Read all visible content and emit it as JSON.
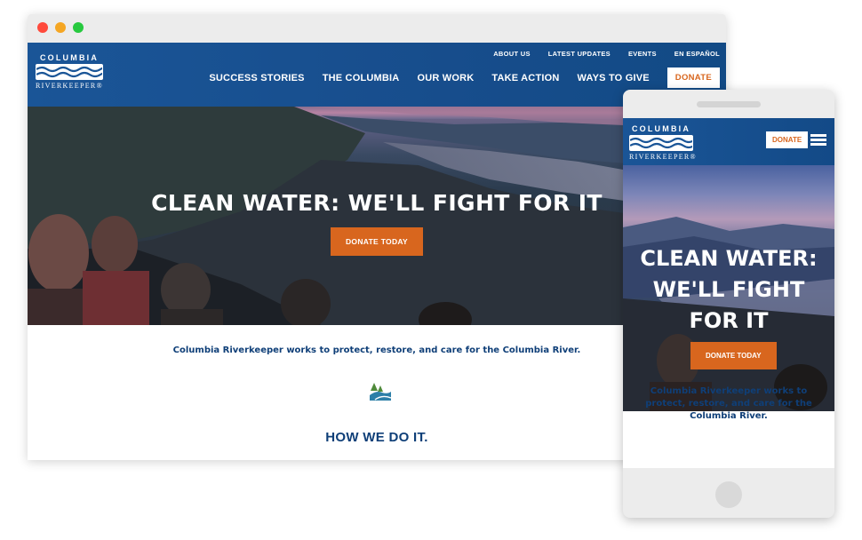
{
  "site": {
    "logo_top": "COLUMBIA",
    "logo_bottom": "RIVERKEEPER®"
  },
  "utility_nav": [
    "ABOUT US",
    "LATEST UPDATES",
    "EVENTS",
    "EN ESPAÑOL"
  ],
  "main_nav": [
    "SUCCESS STORIES",
    "THE COLUMBIA",
    "OUR WORK",
    "TAKE ACTION",
    "WAYS TO GIVE"
  ],
  "donate_label": "DONATE",
  "hero": {
    "title": "CLEAN WATER: WE'LL FIGHT FOR IT",
    "button": "DONATE TODAY"
  },
  "mission": "Columbia Riverkeeper works to protect, restore, and care for the Columbia River.",
  "section_heading": "HOW WE DO IT.",
  "mobile": {
    "donate_label": "DONATE",
    "hero_title": "CLEAN WATER: WE'LL FIGHT FOR IT",
    "hero_button": "DONATE TODAY",
    "mission": "Columbia Riverkeeper works to protect, restore, and care for the Columbia River."
  },
  "colors": {
    "header_blue": "#1a5597",
    "accent_orange": "#d8661e",
    "text_navy": "#0f3f78"
  },
  "icons": [
    "menu-icon",
    "river-emblem-icon"
  ]
}
